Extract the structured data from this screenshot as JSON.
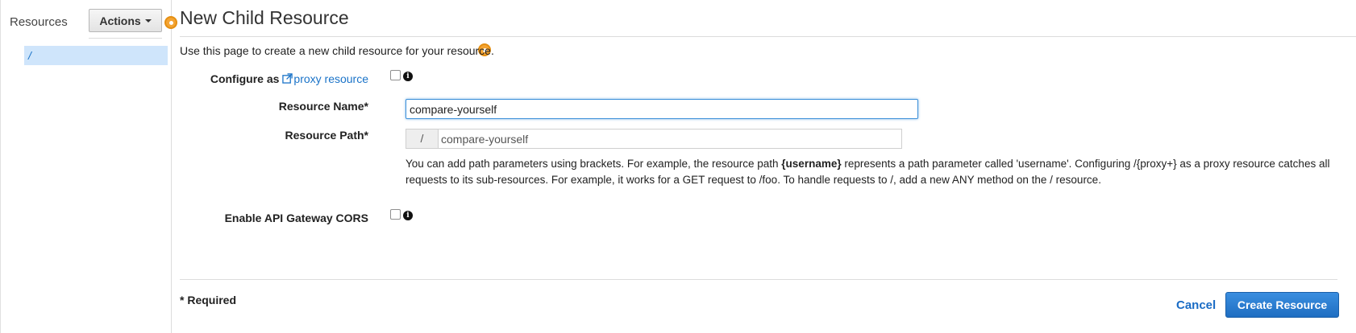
{
  "sidebar": {
    "title": "Resources",
    "actions_label": "Actions",
    "tree_items": [
      "/"
    ]
  },
  "main": {
    "title": "New Child Resource",
    "description": "Use this page to create a new child resource for your resource.",
    "form": {
      "configure_label_prefix": "Configure as",
      "configure_link_text": "proxy resource",
      "resource_name_label": "Resource Name*",
      "resource_name_value": "compare-yourself",
      "resource_path_label": "Resource Path*",
      "resource_path_prefix": "/",
      "resource_path_value": "compare-yourself",
      "help_text_1": "You can add path parameters using brackets. For example, the resource path",
      "help_text_bold": "{username}",
      "help_text_2": "represents a path parameter called 'username'. Configuring /{proxy+} as a proxy resource catches all requests to its sub-resources. For example, it works for a GET request to /foo. To handle requests to /, add a new ANY method on the / resource.",
      "cors_label": "Enable API Gateway CORS"
    },
    "footer": {
      "required_note": "* Required",
      "cancel_label": "Cancel",
      "create_label": "Create Resource"
    }
  },
  "colors": {
    "link": "#1a73c8",
    "primary_button": "#1f6ec2",
    "highlight_dot": "#f4a433",
    "tree_selected": "#cfe5fb"
  },
  "icons": [
    "caret-down-icon",
    "external-link-icon",
    "info-icon",
    "hint-dot-icon"
  ]
}
